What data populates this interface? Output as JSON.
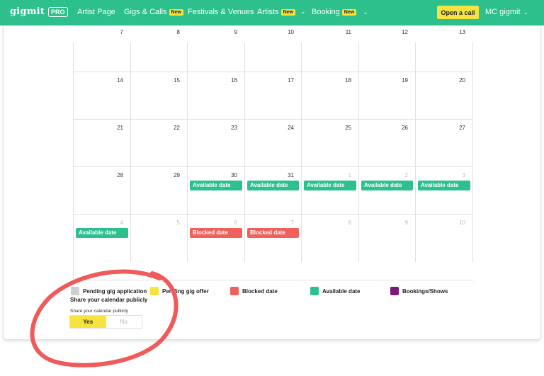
{
  "topbar": {
    "logo": "gigmit",
    "logo_badge": "PRO",
    "nav": [
      {
        "label": "Artist Page"
      },
      {
        "label": "Gigs & Calls",
        "badge": "New"
      },
      {
        "label": "Festivals & Venues"
      },
      {
        "label": "Artists",
        "badge": "New"
      },
      {
        "label": "Booking",
        "badge": "New"
      }
    ],
    "open_call": "Open a call",
    "user": "MC gigmit"
  },
  "calendar": {
    "rows": [
      [
        {
          "d": "7"
        },
        {
          "d": "8"
        },
        {
          "d": "9"
        },
        {
          "d": "10"
        },
        {
          "d": "11"
        },
        {
          "d": "12"
        },
        {
          "d": "13"
        }
      ],
      [
        {
          "d": "14"
        },
        {
          "d": "15"
        },
        {
          "d": "16"
        },
        {
          "d": "17"
        },
        {
          "d": "18"
        },
        {
          "d": "19"
        },
        {
          "d": "20"
        }
      ],
      [
        {
          "d": "21"
        },
        {
          "d": "22"
        },
        {
          "d": "23"
        },
        {
          "d": "24"
        },
        {
          "d": "25"
        },
        {
          "d": "26"
        },
        {
          "d": "27"
        }
      ],
      [
        {
          "d": "28"
        },
        {
          "d": "29"
        },
        {
          "d": "30",
          "event": "Available date",
          "kind": "available"
        },
        {
          "d": "31",
          "event": "Available date",
          "kind": "available"
        },
        {
          "d": "1",
          "muted": true,
          "event": "Available date",
          "kind": "available"
        },
        {
          "d": "2",
          "muted": true,
          "event": "Available date",
          "kind": "available"
        },
        {
          "d": "3",
          "muted": true,
          "event": "Available date",
          "kind": "available"
        }
      ],
      [
        {
          "d": "4",
          "muted": true,
          "event": "Available date",
          "kind": "available"
        },
        {
          "d": "5",
          "muted": true
        },
        {
          "d": "6",
          "muted": true,
          "event": "Blocked date",
          "kind": "blocked"
        },
        {
          "d": "7",
          "muted": true,
          "event": "Blocked date",
          "kind": "blocked"
        },
        {
          "d": "8",
          "muted": true
        },
        {
          "d": "9",
          "muted": true
        },
        {
          "d": "10",
          "muted": true
        }
      ]
    ]
  },
  "legend": [
    {
      "label": "Pending gig application",
      "color": "#cfcfcf"
    },
    {
      "label": "Pending gig offer",
      "color": "#f6e33f"
    },
    {
      "label": "Blocked date",
      "color": "#f0605d"
    },
    {
      "label": "Available date",
      "color": "#2dc08d"
    },
    {
      "label": "Bookings/Shows",
      "color": "#7a1a7a"
    }
  ],
  "colors": {
    "available": "#2dc08d",
    "blocked": "#f0605d",
    "annotation": "#f05a5a"
  },
  "share": {
    "title": "Share your calendar publicly",
    "subtitle": "Share your calendar publicly",
    "yes": "Yes",
    "no": "No"
  }
}
